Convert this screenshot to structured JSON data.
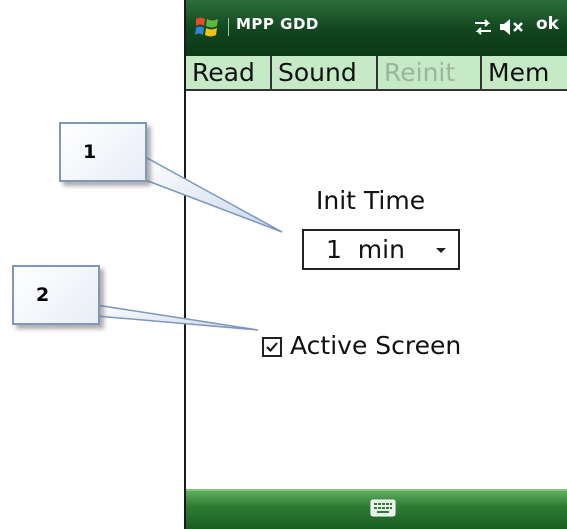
{
  "titlebar": {
    "app_title": "MPP GDD",
    "ok_label": "ok",
    "logo_icon": "windows-logo-icon",
    "sync_icon": "connectivity-icon",
    "speaker_icon": "speaker-muted-icon",
    "background_color": "#11451f"
  },
  "tabs": [
    {
      "label": "Read",
      "enabled": true
    },
    {
      "label": "Sound",
      "enabled": true
    },
    {
      "label": "Reinit",
      "enabled": false
    },
    {
      "label": "Mem",
      "enabled": true
    }
  ],
  "content": {
    "init_time_label": "Init Time",
    "init_time_value": "1  min",
    "active_screen_label": "Active Screen",
    "active_screen_checked": true
  },
  "bottombar": {
    "keyboard_icon": "keyboard-icon"
  },
  "callouts": [
    {
      "number": "1"
    },
    {
      "number": "2"
    }
  ]
}
